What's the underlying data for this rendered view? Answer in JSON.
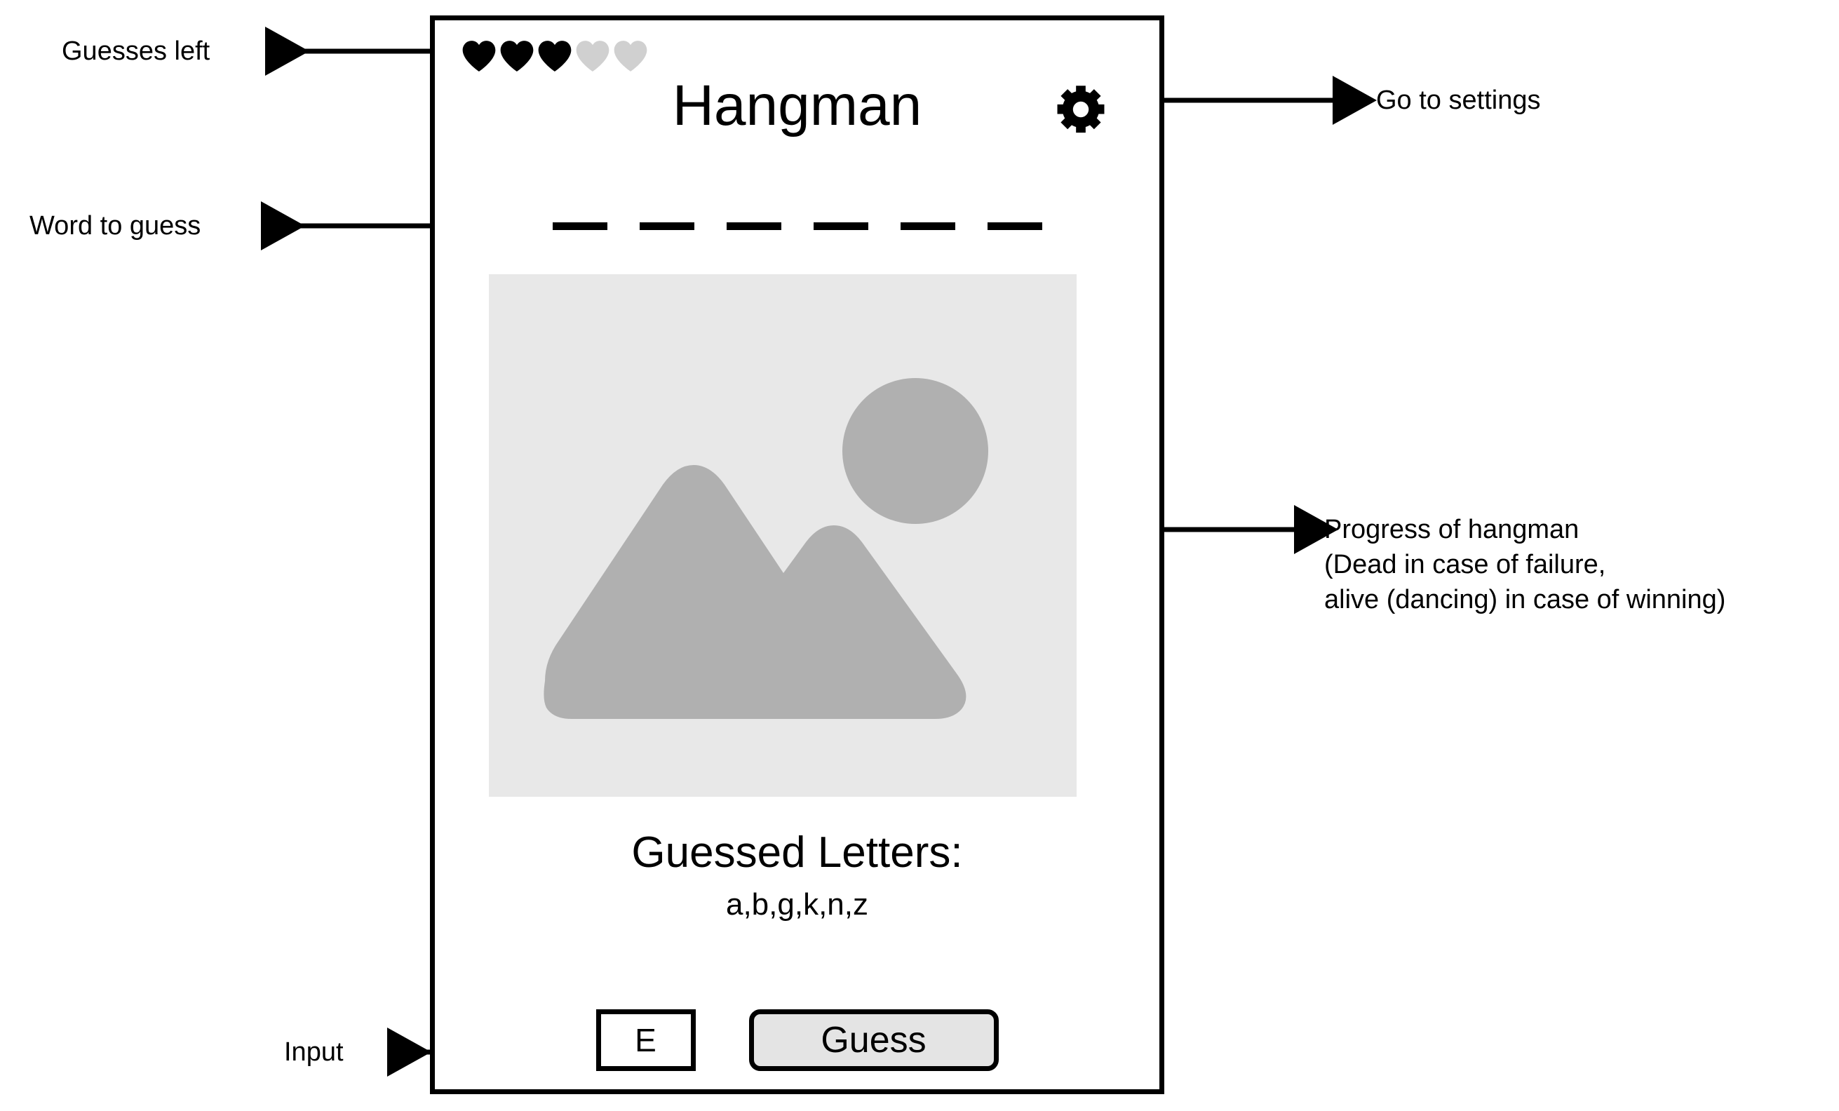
{
  "app": {
    "title": "Hangman",
    "settings_icon": "gear-icon"
  },
  "guesses": {
    "total": 5,
    "remaining": 3,
    "filled_color": "#000000",
    "empty_color": "#d0d0d0",
    "icon": "heart-icon"
  },
  "word": {
    "letter_count": 6,
    "revealed": [
      "",
      "",
      "",
      "",
      "",
      ""
    ]
  },
  "progress_image": {
    "alt": "image-placeholder",
    "background_color": "#e8e8e8",
    "shape_color": "#b0b0b0",
    "shapes": [
      "mountain-icon",
      "sun-circle-icon"
    ]
  },
  "guessed": {
    "title": "Guessed Letters:",
    "letters": "a,b,g,k,n,z"
  },
  "controls": {
    "input_value": "E",
    "input_placeholder": "",
    "guess_label": "Guess",
    "button_fill": "#e4e4e4"
  },
  "annotations": [
    {
      "id": "guesses-left",
      "text": "Guesses left"
    },
    {
      "id": "go-to-settings",
      "text": "Go to settings"
    },
    {
      "id": "word-to-guess",
      "text": "Word to guess"
    },
    {
      "id": "hangman-progress",
      "text": "Progress of hangman\n(Dead in case of failure,\nalive (dancing) in case of winning)"
    },
    {
      "id": "input",
      "text": "Input"
    }
  ]
}
